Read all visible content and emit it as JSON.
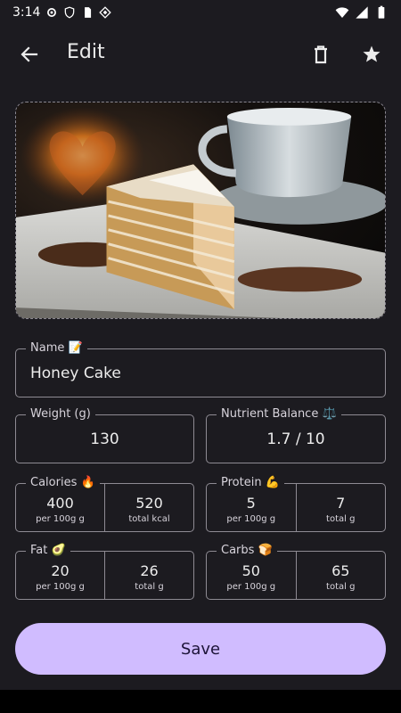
{
  "status_bar": {
    "time": "3:14"
  },
  "app_bar": {
    "title": "Edit"
  },
  "icons": {
    "back": "arrow-back-icon",
    "delete": "trash-icon",
    "favorite": "star-icon"
  },
  "photo": {
    "subject": "honey-cake-with-coffee-cup"
  },
  "name_field": {
    "label": "Name 📝",
    "value": "Honey Cake"
  },
  "weight_field": {
    "label": "Weight (g)",
    "value": "130"
  },
  "balance_field": {
    "label": "Nutrient Balance ⚖️",
    "value": "1.7 / 10"
  },
  "nutrients": {
    "calories": {
      "label": "Calories 🔥",
      "per100": "400",
      "per100_unit": "per 100g g",
      "total": "520",
      "total_unit": "total kcal"
    },
    "protein": {
      "label": "Protein 💪",
      "per100": "5",
      "per100_unit": "per 100g g",
      "total": "7",
      "total_unit": "total g"
    },
    "fat": {
      "label": "Fat 🥑",
      "per100": "20",
      "per100_unit": "per 100g g",
      "total": "26",
      "total_unit": "total g"
    },
    "carbs": {
      "label": "Carbs 🍞",
      "per100": "50",
      "per100_unit": "per 100g g",
      "total": "65",
      "total_unit": "total g"
    }
  },
  "save_button": {
    "label": "Save"
  },
  "colors": {
    "background": "#1c1b20",
    "accent": "#d0bcff",
    "outline": "#8e8b93"
  }
}
